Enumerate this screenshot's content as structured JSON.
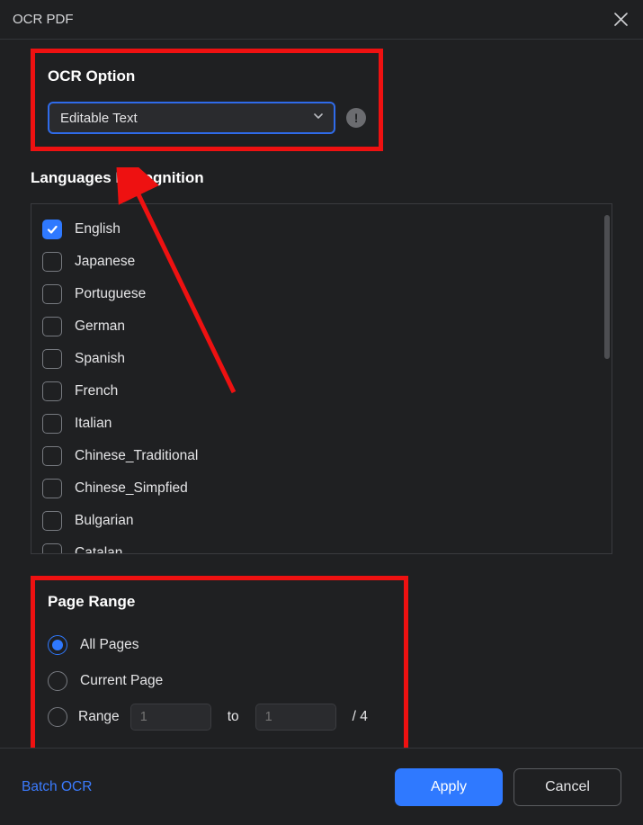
{
  "title": "OCR PDF",
  "ocr_option": {
    "label": "OCR Option",
    "selected": "Editable Text"
  },
  "languages": {
    "label": "Languages Recognition",
    "items": [
      {
        "label": "English",
        "checked": true
      },
      {
        "label": "Japanese",
        "checked": false
      },
      {
        "label": "Portuguese",
        "checked": false
      },
      {
        "label": "German",
        "checked": false
      },
      {
        "label": "Spanish",
        "checked": false
      },
      {
        "label": "French",
        "checked": false
      },
      {
        "label": "Italian",
        "checked": false
      },
      {
        "label": "Chinese_Traditional",
        "checked": false
      },
      {
        "label": "Chinese_Simpfied",
        "checked": false
      },
      {
        "label": "Bulgarian",
        "checked": false
      },
      {
        "label": "Catalan",
        "checked": false
      }
    ]
  },
  "page_range": {
    "label": "Page Range",
    "all_label": "All Pages",
    "current_label": "Current Page",
    "range_label": "Range",
    "selected": "all",
    "from_placeholder": "1",
    "to_placeholder": "1",
    "separator": "to",
    "total": "/ 4"
  },
  "footer": {
    "batch_link": "Batch OCR",
    "apply": "Apply",
    "cancel": "Cancel"
  }
}
